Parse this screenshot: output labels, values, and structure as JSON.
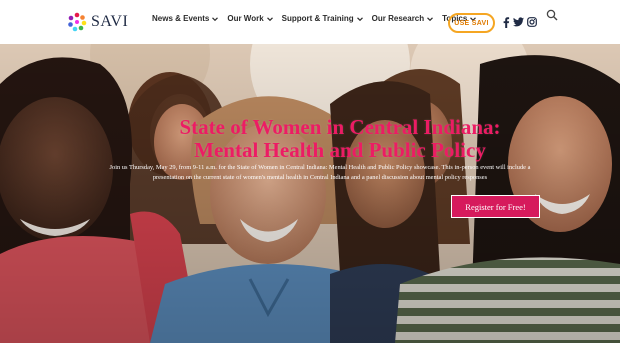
{
  "brand": {
    "name": "SAVI",
    "logo_icon": "flower-dots-icon"
  },
  "nav": {
    "items": [
      {
        "label": "News & Events"
      },
      {
        "label": "Our Work"
      },
      {
        "label": "Support & Training"
      },
      {
        "label": "Our Research"
      },
      {
        "label": "Topics"
      }
    ],
    "cta_label": "USE SAVI",
    "social": [
      "facebook-icon",
      "twitter-icon",
      "instagram-icon"
    ],
    "search_icon": "search-icon"
  },
  "hero": {
    "title_line1": "State of Women in Central Indiana:",
    "title_line2": "Mental Health and Public Policy",
    "description_line1": "Join us Thursday, May 29, from 9-11 a.m. for the State of Women in Central Indiana: Mental Health and Public Policy showcase. This in-person event will include a",
    "description_line2": "presentation on the current state of women's mental health in Central Indiana and a panel discussion about mental policy responses",
    "register_label": "Register for Free!"
  },
  "colors": {
    "accent_pink": "#ec1c64",
    "button_pink": "#d61a5c",
    "cta_orange": "#f5a623",
    "nav_text": "#2b2b2b"
  }
}
